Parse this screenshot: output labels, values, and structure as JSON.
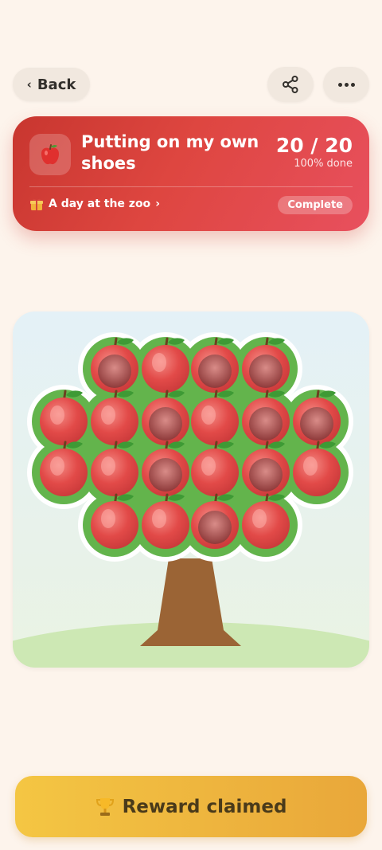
{
  "nav": {
    "back_label": "Back"
  },
  "goal": {
    "icon": "apple-icon",
    "title": "Putting on my own shoes",
    "count": "20 / 20",
    "percent_text": "100% done",
    "reward_text": "A day at the zoo",
    "status_badge": "Complete",
    "colors": {
      "card_start": "#c8362f",
      "card_end": "#e8505e"
    }
  },
  "tree": {
    "total_slots": 20,
    "filled": 20,
    "apples": [
      {
        "row": 0,
        "col": 1,
        "state": "filled"
      },
      {
        "row": 0,
        "col": 2,
        "state": "filled"
      },
      {
        "row": 0,
        "col": 3,
        "state": "filled"
      },
      {
        "row": 0,
        "col": 4,
        "state": "filled"
      },
      {
        "row": 1,
        "col": 0,
        "state": "filled"
      },
      {
        "row": 1,
        "col": 1,
        "state": "filled"
      },
      {
        "row": 1,
        "col": 2,
        "state": "filled"
      },
      {
        "row": 1,
        "col": 3,
        "state": "filled"
      },
      {
        "row": 1,
        "col": 4,
        "state": "filled"
      },
      {
        "row": 1,
        "col": 5,
        "state": "filled"
      },
      {
        "row": 2,
        "col": 0,
        "state": "filled"
      },
      {
        "row": 2,
        "col": 1,
        "state": "filled"
      },
      {
        "row": 2,
        "col": 2,
        "state": "filled"
      },
      {
        "row": 2,
        "col": 3,
        "state": "filled"
      },
      {
        "row": 2,
        "col": 4,
        "state": "filled"
      },
      {
        "row": 2,
        "col": 5,
        "state": "filled"
      },
      {
        "row": 3,
        "col": 1,
        "state": "filled"
      },
      {
        "row": 3,
        "col": 2,
        "state": "filled"
      },
      {
        "row": 3,
        "col": 3,
        "state": "filled"
      },
      {
        "row": 3,
        "col": 4,
        "state": "filled"
      }
    ],
    "colors": {
      "foliage": "#63b44c",
      "trunk": "#9b6435",
      "apple": "#e24a48",
      "grass": "#cde8b4"
    }
  },
  "footer": {
    "reward_button_label": "Reward claimed",
    "icon": "trophy-icon"
  }
}
